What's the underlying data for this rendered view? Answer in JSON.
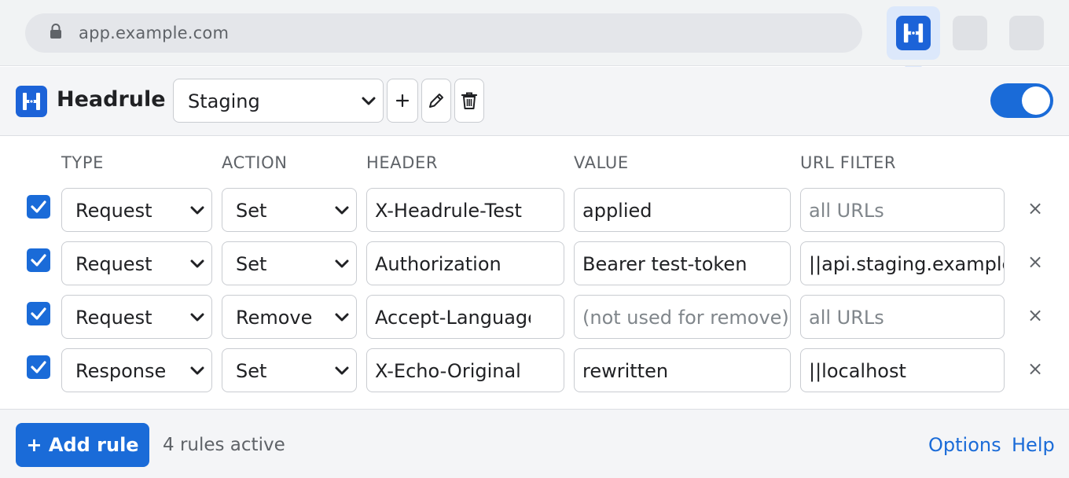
{
  "browser": {
    "url": "app.example.com",
    "lock_icon": "lock-icon",
    "extension_icon": "headrule-logo-icon"
  },
  "header": {
    "app_name": "Headrule",
    "profile_selected": "Staging",
    "add_profile_icon": "plus-icon",
    "edit_profile_icon": "pencil-icon",
    "delete_profile_icon": "trash-icon",
    "enabled": true
  },
  "columns": {
    "type": "TYPE",
    "action": "ACTION",
    "header": "HEADER",
    "value": "VALUE",
    "url_filter": "URL FILTER"
  },
  "rules": [
    {
      "enabled": true,
      "type": "Request",
      "action": "Set",
      "header": "X-Headrule-Test",
      "value": "applied",
      "value_placeholder": "",
      "url_filter": "",
      "url_placeholder": "all URLs",
      "remove_label": "×"
    },
    {
      "enabled": true,
      "type": "Request",
      "action": "Set",
      "header": "Authorization",
      "value": "Bearer test-token",
      "value_placeholder": "",
      "url_filter": "||api.staging.example",
      "url_placeholder": "",
      "remove_label": "×"
    },
    {
      "enabled": true,
      "type": "Request",
      "action": "Remove",
      "header": "Accept-Language",
      "value": "",
      "value_placeholder": "(not used for remove)",
      "url_filter": "",
      "url_placeholder": "all URLs",
      "remove_label": "×"
    },
    {
      "enabled": true,
      "type": "Response",
      "action": "Set",
      "header": "X-Echo-Original",
      "value": "rewritten",
      "value_placeholder": "",
      "url_filter": "||localhost",
      "url_placeholder": "",
      "remove_label": "×"
    }
  ],
  "footer": {
    "add_rule_label": "+ Add rule",
    "status": "4 rules active",
    "options_link": "Options",
    "help_link": "Help"
  },
  "colors": {
    "accent": "#1a6bd8",
    "logo": "#1c63d8",
    "muted_text": "#5f6368",
    "placeholder": "#80868b"
  }
}
